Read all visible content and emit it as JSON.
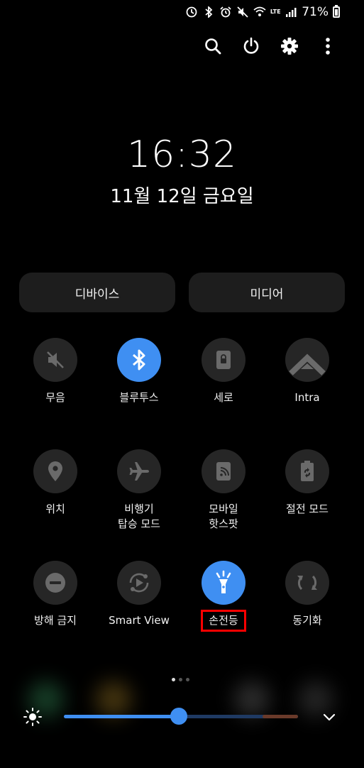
{
  "status_bar": {
    "network_type": "LTE",
    "battery_percent": "71%",
    "icons": [
      "data-saver-icon",
      "bluetooth-icon",
      "alarm-icon",
      "mute-icon",
      "wifi-icon",
      "lte-icon",
      "signal-icon",
      "battery-charging-icon"
    ]
  },
  "toolbar": {
    "icons": [
      "search-icon",
      "power-icon",
      "settings-icon",
      "more-options-icon"
    ]
  },
  "clock": {
    "time": "16:32",
    "date": "11월 12일 금요일"
  },
  "pills": {
    "device": "디바이스",
    "media": "미디어"
  },
  "tiles": [
    {
      "label": "무음",
      "icon": "mute-icon",
      "active": false
    },
    {
      "label": "블루투스",
      "icon": "bluetooth-icon",
      "active": true
    },
    {
      "label": "세로",
      "icon": "portrait-lock-icon",
      "active": false
    },
    {
      "label": "Intra",
      "icon": "intra-icon",
      "active": false
    },
    {
      "label": "위치",
      "icon": "location-icon",
      "active": false
    },
    {
      "label": "비행기\n탑승 모드",
      "icon": "airplane-icon",
      "active": false
    },
    {
      "label": "모바일\n핫스팟",
      "icon": "hotspot-icon",
      "active": false
    },
    {
      "label": "절전 모드",
      "icon": "power-saving-icon",
      "active": false
    },
    {
      "label": "방해 금지",
      "icon": "do-not-disturb-icon",
      "active": false
    },
    {
      "label": "Smart View",
      "icon": "smart-view-icon",
      "active": false
    },
    {
      "label": "손전등",
      "icon": "flashlight-icon",
      "active": true
    },
    {
      "label": "동기화",
      "icon": "sync-icon",
      "active": false
    }
  ],
  "page_indicator": {
    "total": 3,
    "current": 1
  },
  "brightness": {
    "level": 0.49
  },
  "colors": {
    "accent": "#3f8ff2",
    "tile_bg": "#262626",
    "pill_bg": "#1d1d1d",
    "highlight": "#ff0000"
  }
}
